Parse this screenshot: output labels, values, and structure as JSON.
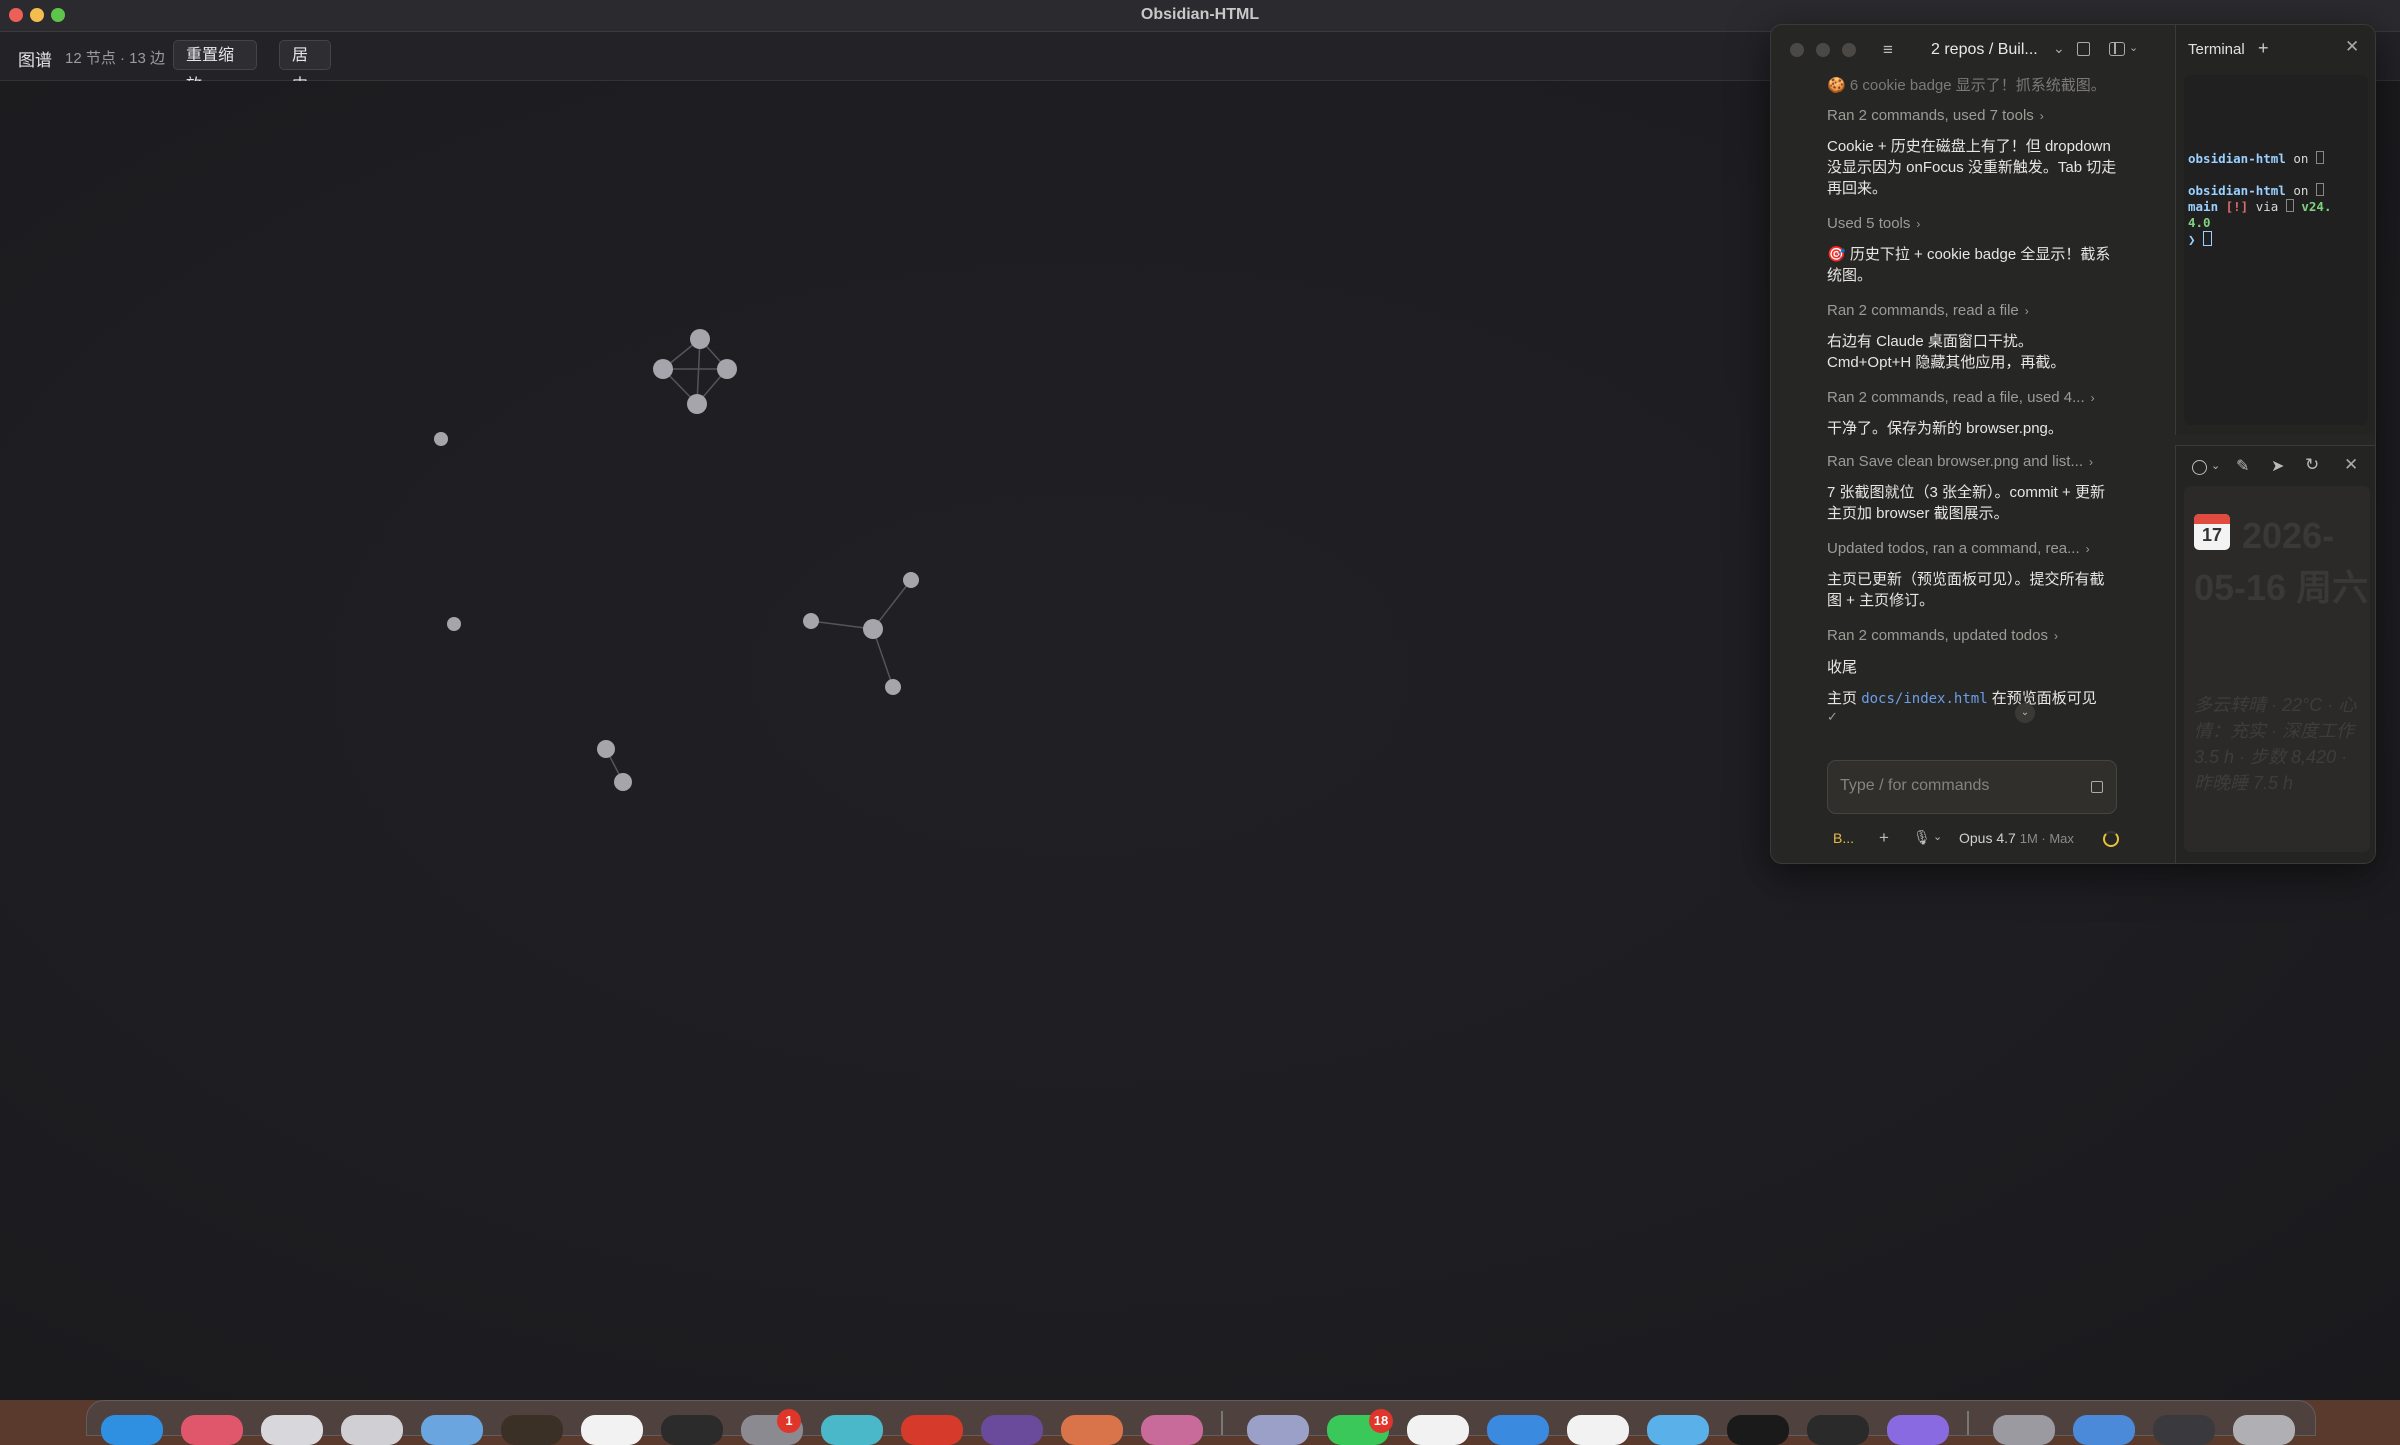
{
  "window": {
    "title": "Obsidian-HTML"
  },
  "graph_toolbar": {
    "title": "图谱",
    "stats": "12 节点 · 13 边",
    "reset_zoom": "重置缩放",
    "center": "居中"
  },
  "claude": {
    "repo_label": "2 repos / Buil...",
    "messages": {
      "m0": "🍪 6 cookie badge 显示了！抓系统截图。",
      "t1": "Ran 2 commands, used 7 tools",
      "m2": "Cookie + 历史在磁盘上有了！但 dropdown 没显示因为 onFocus 没重新触发。Tab 切走再回来。",
      "t3": "Used 5 tools",
      "m4": "🎯 历史下拉 + cookie badge 全显示！截系统图。",
      "t5": "Ran 2 commands, read a file",
      "m6": "右边有 Claude 桌面窗口干扰。Cmd+Opt+H 隐藏其他应用，再截。",
      "t7": "Ran 2 commands, read a file, used 4...",
      "m8": "干净了。保存为新的 browser.png。",
      "t9": "Ran Save clean browser.png and list...",
      "m10": "7 张截图就位（3 张全新）。commit + 更新主页加 browser 截图展示。",
      "t11": "Updated todos, ran a command, rea...",
      "m12": "主页已更新（预览面板可见）。提交所有截图 + 主页修订。",
      "t13": "Ran 2 commands, updated todos",
      "m14": "收尾",
      "m15_a": "主页",
      "m15_code": "docs/index.html",
      "m15_b": "在预览面板可见",
      "check": "✓"
    },
    "input_placeholder": "Type / for commands",
    "bottom": {
      "branch": "B...",
      "model": "Opus 4.7",
      "model_sub": "1M · Max"
    }
  },
  "terminal": {
    "tab": "Terminal",
    "lines": {
      "l1_dir": "obsidian-html",
      "l1_on": " on ",
      "l2_dir": "obsidian-html",
      "l2_on": " on ",
      "l3_branch": "main",
      "l3_flag": " [!]",
      "l3_via": " via ",
      "l3_ver": " v24.",
      "l4_ver": "4.0",
      "prompt": "❯ "
    }
  },
  "preview": {
    "cal_day": "17",
    "date_a": "2026-",
    "date_b": "05-16 周六",
    "summary": "多云转晴 · 22°C · 心情：充实 · 深度工作 3.5 h · 步数 8,420 · 昨晚睡 7.5 h"
  },
  "dock": {
    "badges": {
      "settings": "1",
      "messages": "18"
    }
  },
  "colors": {
    "node": "#a6a5ac",
    "edge": "#55545a",
    "accent": "#e9c03a"
  },
  "graph_nodes": [
    {
      "id": "a1"
    },
    {
      "id": "a2"
    },
    {
      "id": "a3"
    },
    {
      "id": "a4"
    },
    {
      "id": "b"
    },
    {
      "id": "c"
    },
    {
      "id": "d1"
    },
    {
      "id": "d2"
    },
    {
      "id": "d3"
    },
    {
      "id": "d4"
    },
    {
      "id": "e1"
    },
    {
      "id": "e2"
    }
  ]
}
